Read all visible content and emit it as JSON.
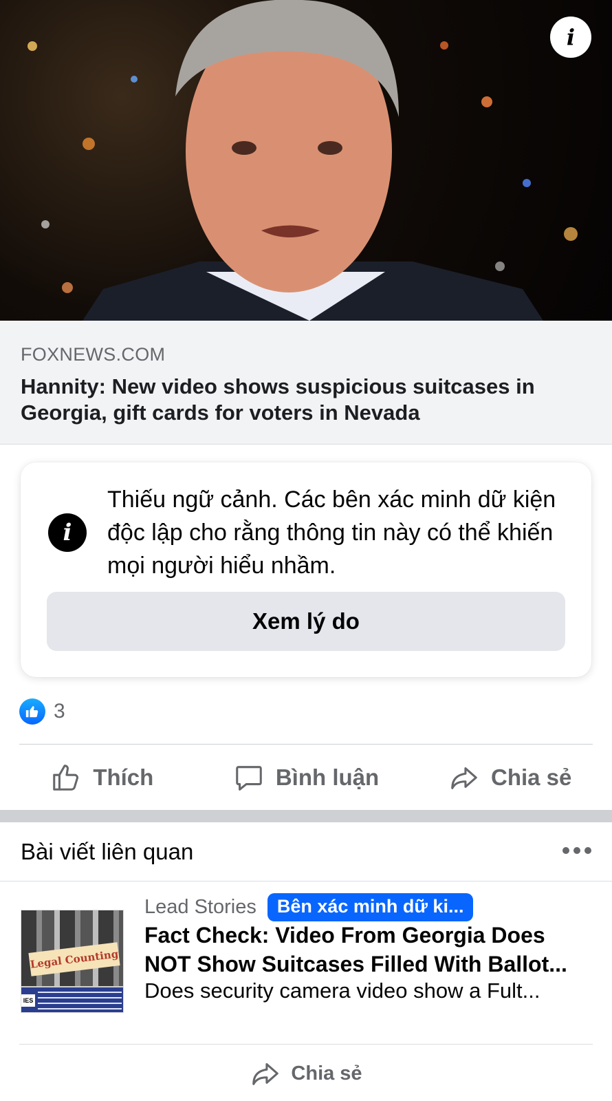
{
  "hero": {
    "info_icon": "info-icon",
    "image_alt": "news-anchor-photo"
  },
  "link_preview": {
    "domain": "FOXNEWS.COM",
    "title": "Hannity: New video shows suspicious suitcases in Georgia, gift cards for voters in Nevada"
  },
  "fact_check": {
    "icon": "info-icon",
    "text": "Thiếu ngữ cảnh. Các bên xác minh dữ kiện độc lập cho rằng thông tin này có thể khiến mọi người hiểu nhầm.",
    "button_label": "Xem lý do"
  },
  "reactions": {
    "count": "3",
    "icon": "like-icon",
    "color": "#0866ff"
  },
  "actions": [
    {
      "label": "Thích",
      "icon": "thumbs-up-icon"
    },
    {
      "label": "Bình luận",
      "icon": "comment-icon"
    },
    {
      "label": "Chia sẻ",
      "icon": "share-icon"
    }
  ],
  "related": {
    "header": "Bài viết liên quan",
    "more_icon": "more-icon",
    "item": {
      "thumbnail_banner": "Legal Counting",
      "thumbnail_tag": "IES",
      "source": "Lead Stories",
      "badge": "Bên xác minh dữ ki...",
      "headline_line1": "Fact Check: Video From Georgia Does",
      "headline_line2": "NOT Show Suitcases Filled With Ballot...",
      "description": "Does security camera video show a Fult..."
    },
    "share_label": "Chia sẻ"
  }
}
